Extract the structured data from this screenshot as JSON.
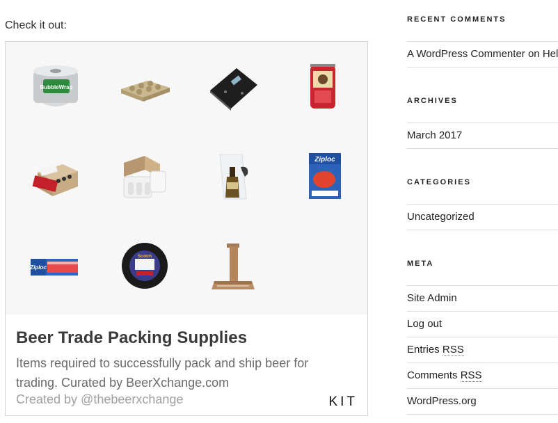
{
  "post": {
    "intro_text": "Check it out:"
  },
  "kit": {
    "title": "Beer Trade Packing Supplies",
    "description": "Items required to successfully pack and ship beer for trading. Curated by BeerXchange.com",
    "creator": "Created by @thebeerxchange",
    "logo": "KIT",
    "products": [
      {
        "icon": "bubble-wrap-roll-icon",
        "label": "BubbleWrap"
      },
      {
        "icon": "pulp-bottle-tray-icon",
        "label": ""
      },
      {
        "icon": "digital-scale-icon",
        "label": ""
      },
      {
        "icon": "tape-dispenser-icon",
        "label": ""
      },
      {
        "icon": "bottle-shipping-box-icon",
        "label": ""
      },
      {
        "icon": "foam-shipper-box-icon",
        "label": ""
      },
      {
        "icon": "bottle-bag-icon",
        "label": ""
      },
      {
        "icon": "ziploc-box-icon",
        "label": "Ziploc"
      },
      {
        "icon": "ziploc-bags-icon",
        "label": "Ziploc"
      },
      {
        "icon": "electrical-tape-icon",
        "label": "Scotch"
      },
      {
        "icon": "cardboard-divider-icon",
        "label": ""
      }
    ]
  },
  "sidebar": {
    "recent_comments": {
      "title": "RECENT COMMENTS",
      "items": [
        {
          "author": "A WordPress Commenter",
          "joiner": " on ",
          "post": "Hello world!"
        }
      ]
    },
    "archives": {
      "title": "ARCHIVES",
      "items": [
        "March 2017"
      ]
    },
    "categories": {
      "title": "CATEGORIES",
      "items": [
        "Uncategorized"
      ]
    },
    "meta": {
      "title": "META",
      "site_admin": "Site Admin",
      "log_out": "Log out",
      "entries": "Entries ",
      "entries_abbr": "RSS",
      "comments": "Comments ",
      "comments_abbr": "RSS",
      "wordpress": "WordPress.org"
    }
  }
}
